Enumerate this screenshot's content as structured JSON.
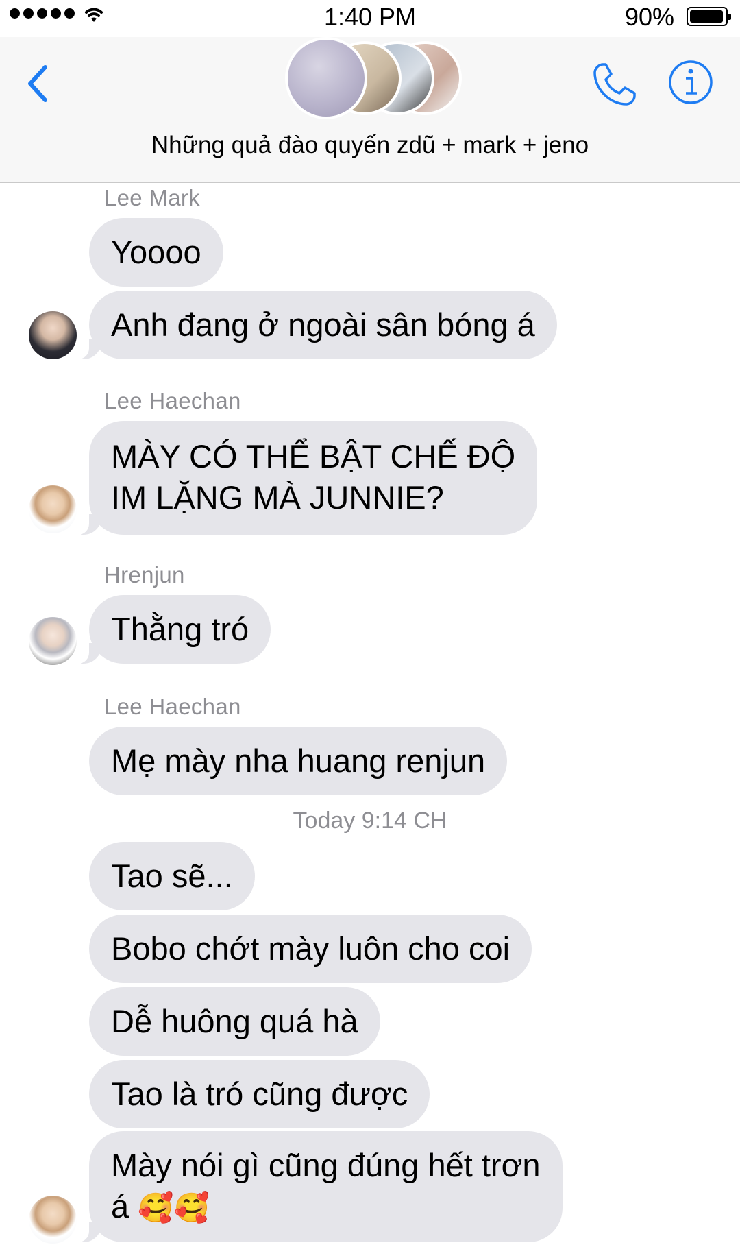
{
  "status_bar": {
    "time": "1:40 PM",
    "battery": "90%"
  },
  "header": {
    "title": "Những quả đào quyến zdũ + mark + jeno"
  },
  "messages": [
    {
      "sender": "Lee Mark",
      "bubbles": [
        "Yoooo",
        "Anh đang ở ngoài sân bóng á"
      ]
    },
    {
      "sender": "Lee Haechan",
      "lines": [
        "MÀY CÓ THỂ BẬT CHẾ ĐỘ",
        "IM LẶNG MÀ JUNNIE?"
      ]
    },
    {
      "sender": "Hrenjun",
      "bubbles": [
        "Thằng tró"
      ]
    },
    {
      "sender": "Lee Haechan",
      "bubbles": [
        "Mẹ mày nha huang renjun"
      ]
    }
  ],
  "timestamp": "Today 9:14 CH",
  "after_time": {
    "bubbles": [
      "Tao sẽ...",
      "Bobo chớt mày luôn cho coi",
      "Dễ huông quá hà",
      "Tao là tró cũng được"
    ],
    "last_line1": "Mày nói gì cũng đúng hết trơn",
    "last_line2": "á",
    "last_emoji": "🥰🥰"
  },
  "icons": [
    "back-chevron-icon",
    "phone-icon",
    "info-icon",
    "wifi-icon",
    "battery-icon"
  ],
  "colors": {
    "accent": "#1e7cf2",
    "bubble": "#e5e5ea",
    "meta_text": "#8e8e93"
  }
}
